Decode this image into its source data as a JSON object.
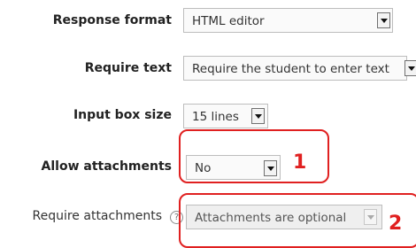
{
  "fields": [
    {
      "label": "Response format",
      "value": "HTML editor"
    },
    {
      "label": "Require text",
      "value": "Require the student to enter text"
    },
    {
      "label": "Input box size",
      "value": "15 lines"
    },
    {
      "label": "Allow attachments",
      "value": "No"
    },
    {
      "label": "Require attachments",
      "value": "Attachments are optional",
      "help_icon": "?",
      "disabled": true
    }
  ],
  "callouts": [
    {
      "number": "1"
    },
    {
      "number": "2"
    }
  ],
  "colors": {
    "callout": "#e02020"
  }
}
